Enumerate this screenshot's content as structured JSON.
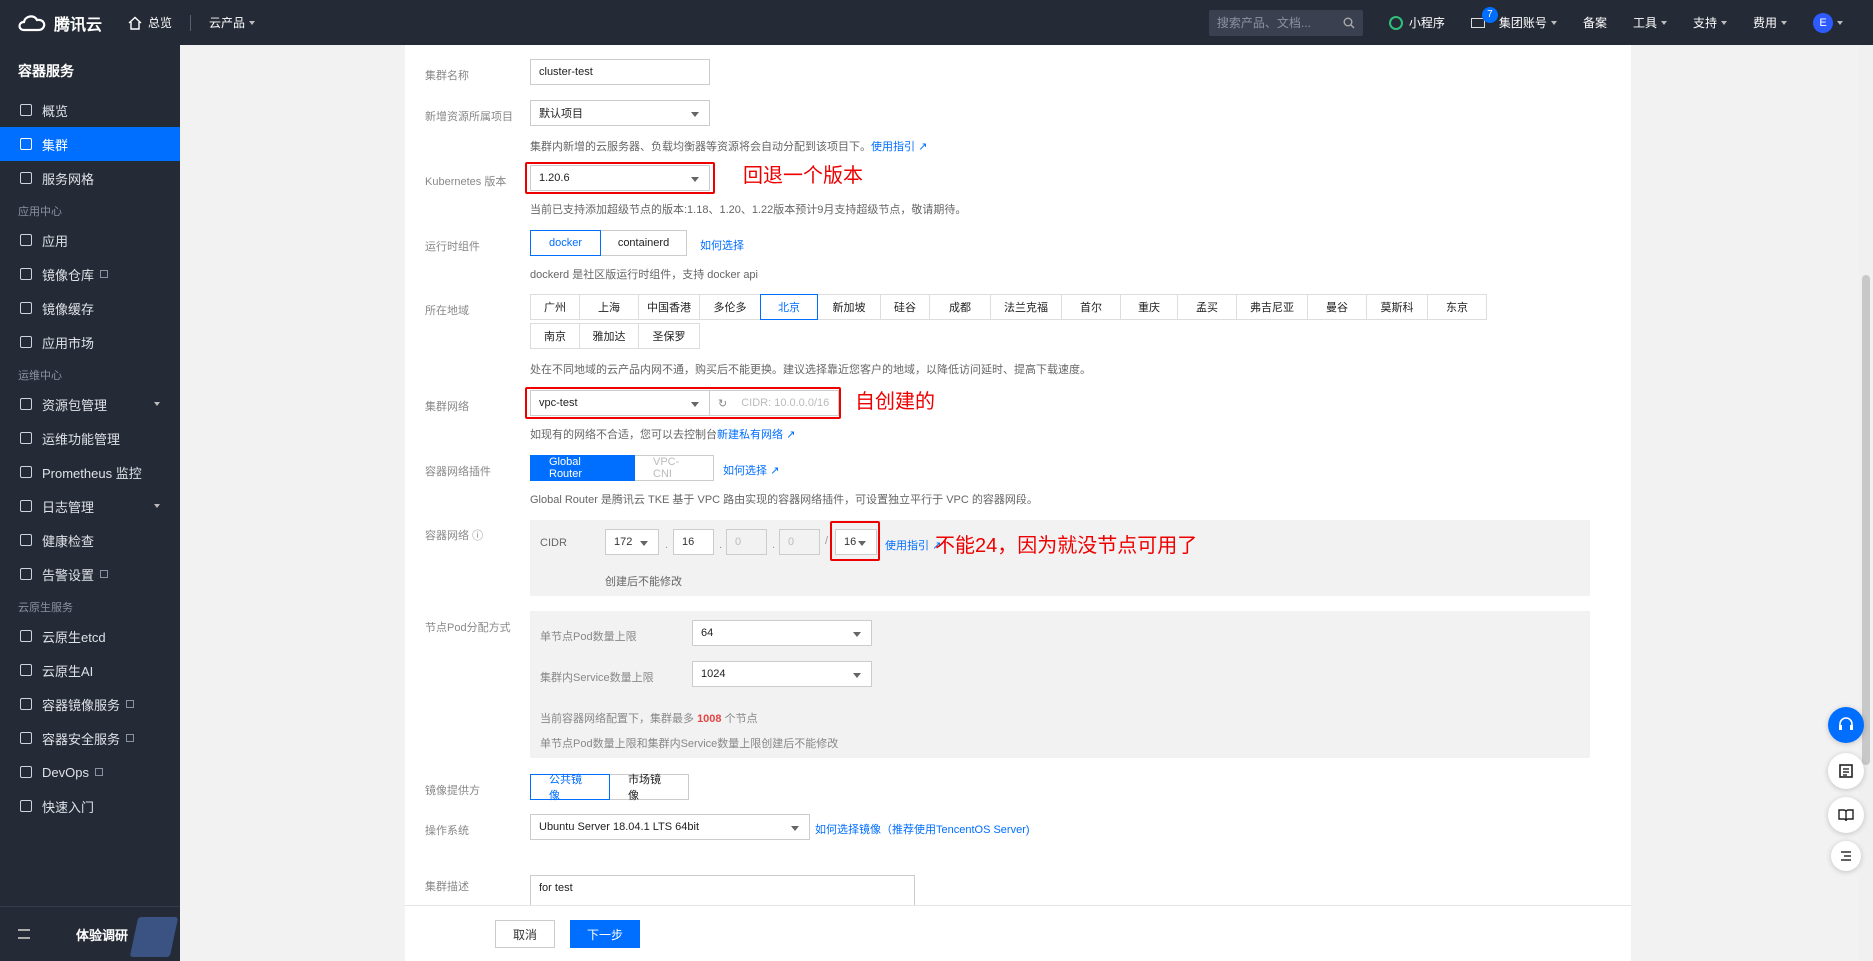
{
  "topbar": {
    "brand": "腾讯云",
    "home": "总览",
    "products": "云产品",
    "search_placeholder": "搜索产品、文档...",
    "mini_program": "小程序",
    "mail_count": "7",
    "account": "集团账号",
    "beian": "备案",
    "tools": "工具",
    "support": "支持",
    "billing": "费用",
    "avatar": "E"
  },
  "sidebar": {
    "title": "容器服务",
    "items": [
      {
        "label": "概览"
      },
      {
        "label": "集群"
      },
      {
        "label": "服务网格"
      }
    ],
    "group_app": "应用中心",
    "app_items": [
      {
        "label": "应用"
      },
      {
        "label": "镜像仓库"
      },
      {
        "label": "镜像缓存"
      },
      {
        "label": "应用市场"
      }
    ],
    "group_ops": "运维中心",
    "ops_items": [
      {
        "label": "资源包管理"
      },
      {
        "label": "运维功能管理"
      },
      {
        "label": "Prometheus 监控"
      },
      {
        "label": "日志管理"
      },
      {
        "label": "健康检查"
      },
      {
        "label": "告警设置"
      }
    ],
    "group_native": "云原生服务",
    "native_items": [
      {
        "label": "云原生etcd"
      },
      {
        "label": "云原生AI"
      },
      {
        "label": "容器镜像服务"
      },
      {
        "label": "容器安全服务"
      },
      {
        "label": "DevOps"
      },
      {
        "label": "快速入门"
      }
    ],
    "feedback": "体验调研"
  },
  "form": {
    "cluster_name_label": "集群名称",
    "cluster_name_value": "cluster-test",
    "project_label": "新增资源所属项目",
    "project_value": "默认项目",
    "project_hint": "集群内新增的云服务器、负载均衡器等资源将会自动分配到该项目下。",
    "project_hint_link": "使用指引",
    "k8s_label": "Kubernetes 版本",
    "k8s_value": "1.20.6",
    "k8s_hint": "当前已支持添加超级节点的版本:1.18、1.20、1.22版本预计9月支持超级节点，敬请期待。",
    "runtime_label": "运行时组件",
    "runtime_options": [
      "docker",
      "containerd"
    ],
    "runtime_link": "如何选择",
    "runtime_hint": "dockerd 是社区版运行时组件，支持 docker api",
    "region_label": "所在地域",
    "regions_row1": [
      "广州",
      "上海",
      "中国香港",
      "多伦多",
      "北京",
      "新加坡",
      "硅谷",
      "成都",
      "法兰克福",
      "首尔",
      "重庆",
      "孟买",
      "弗吉尼亚",
      "曼谷",
      "莫斯科",
      "东京"
    ],
    "regions_row2": [
      "南京",
      "雅加达",
      "圣保罗"
    ],
    "region_selected": "北京",
    "region_hint": "处在不同地域的云产品内网不通，购买后不能更换。建议选择靠近您客户的地域，以降低访问延时、提高下载速度。",
    "network_label": "集群网络",
    "network_value": "vpc-test",
    "network_cidr": "CIDR: 10.0.0.0/16",
    "network_hint": "如现有的网络不合适，您可以去控制台",
    "network_hint_link": "新建私有网络",
    "plugin_label": "容器网络插件",
    "plugin_options": [
      "Global Router",
      "VPC-CNI"
    ],
    "plugin_link": "如何选择",
    "plugin_hint": "Global Router 是腾讯云 TKE 基于 VPC 路由实现的容器网络插件，可设置独立平行于 VPC 的容器网段。",
    "cidr_label": "容器网络",
    "cidr_title": "CIDR",
    "cidr_parts": [
      "172",
      "16",
      "0",
      "0"
    ],
    "cidr_mask": "16",
    "cidr_link": "使用指引",
    "cidr_hint": "创建后不能修改",
    "pod_label": "节点Pod分配方式",
    "pod_max_label": "单节点Pod数量上限",
    "pod_max_value": "64",
    "svc_max_label": "集群内Service数量上限",
    "svc_max_value": "1024",
    "pod_summary_prefix": "当前容器网络配置下，集群最多",
    "pod_summary_num": "1008",
    "pod_summary_suffix": "个节点",
    "pod_summary_note": "单节点Pod数量上限和集群内Service数量上限创建后不能修改",
    "image_label": "镜像提供方",
    "image_options": [
      "公共镜像",
      "市场镜像"
    ],
    "os_label": "操作系统",
    "os_value": "Ubuntu Server 18.04.1 LTS 64bit",
    "os_link": "如何选择镜像（推荐使用TencentOS Server)",
    "desc_label": "集群描述",
    "desc_value": "for test",
    "cancel": "取消",
    "next": "下一步"
  },
  "annotations": {
    "k8s_note": "回退一个版本",
    "network_note": "自创建的",
    "cidr_note": "不能24，因为就没节点可用了"
  },
  "colors": {
    "accent": "#006eff",
    "annotation": "#ee0000",
    "nav_bg": "#242a36"
  }
}
